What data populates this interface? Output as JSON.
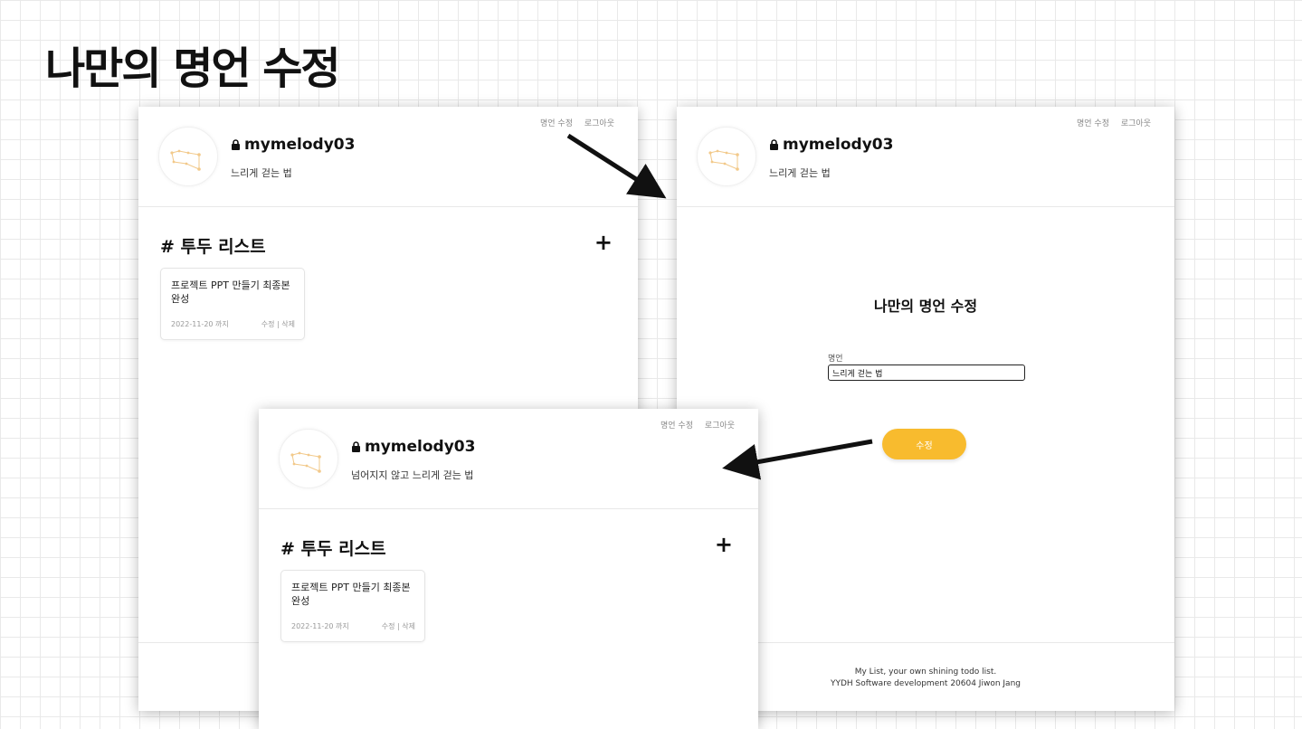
{
  "slide": {
    "title": "나만의 명언 수정"
  },
  "nav": {
    "edit_quote": "명언 수정",
    "logout": "로그아웃"
  },
  "profile": {
    "username": "mymelody03",
    "quote_before": "느리게 걷는 법",
    "quote_after": "넘어지지 않고 느리게 걷는 법"
  },
  "todo": {
    "section_title": "# 투두 리스트",
    "add_label": "+",
    "items": [
      {
        "text": "프로젝트 PPT 만들기 최종본 완성",
        "due": "2022-11-20 까지",
        "edit": "수정",
        "separator": "|",
        "delete": "삭제"
      }
    ]
  },
  "edit_form": {
    "title": "나만의 명언 수정",
    "label": "명언",
    "value": "느리게 걷는 법",
    "submit": "수정"
  },
  "footer": {
    "line1": "My List, your own shining todo list.",
    "line2": "YYDH Software development 20604 Jiwon Jang"
  },
  "colors": {
    "accent": "#f8bb2e",
    "constellation": "#f2c98a"
  },
  "icons": {
    "lock": "lock-icon",
    "avatar": "constellation-icon",
    "add": "plus-icon"
  }
}
